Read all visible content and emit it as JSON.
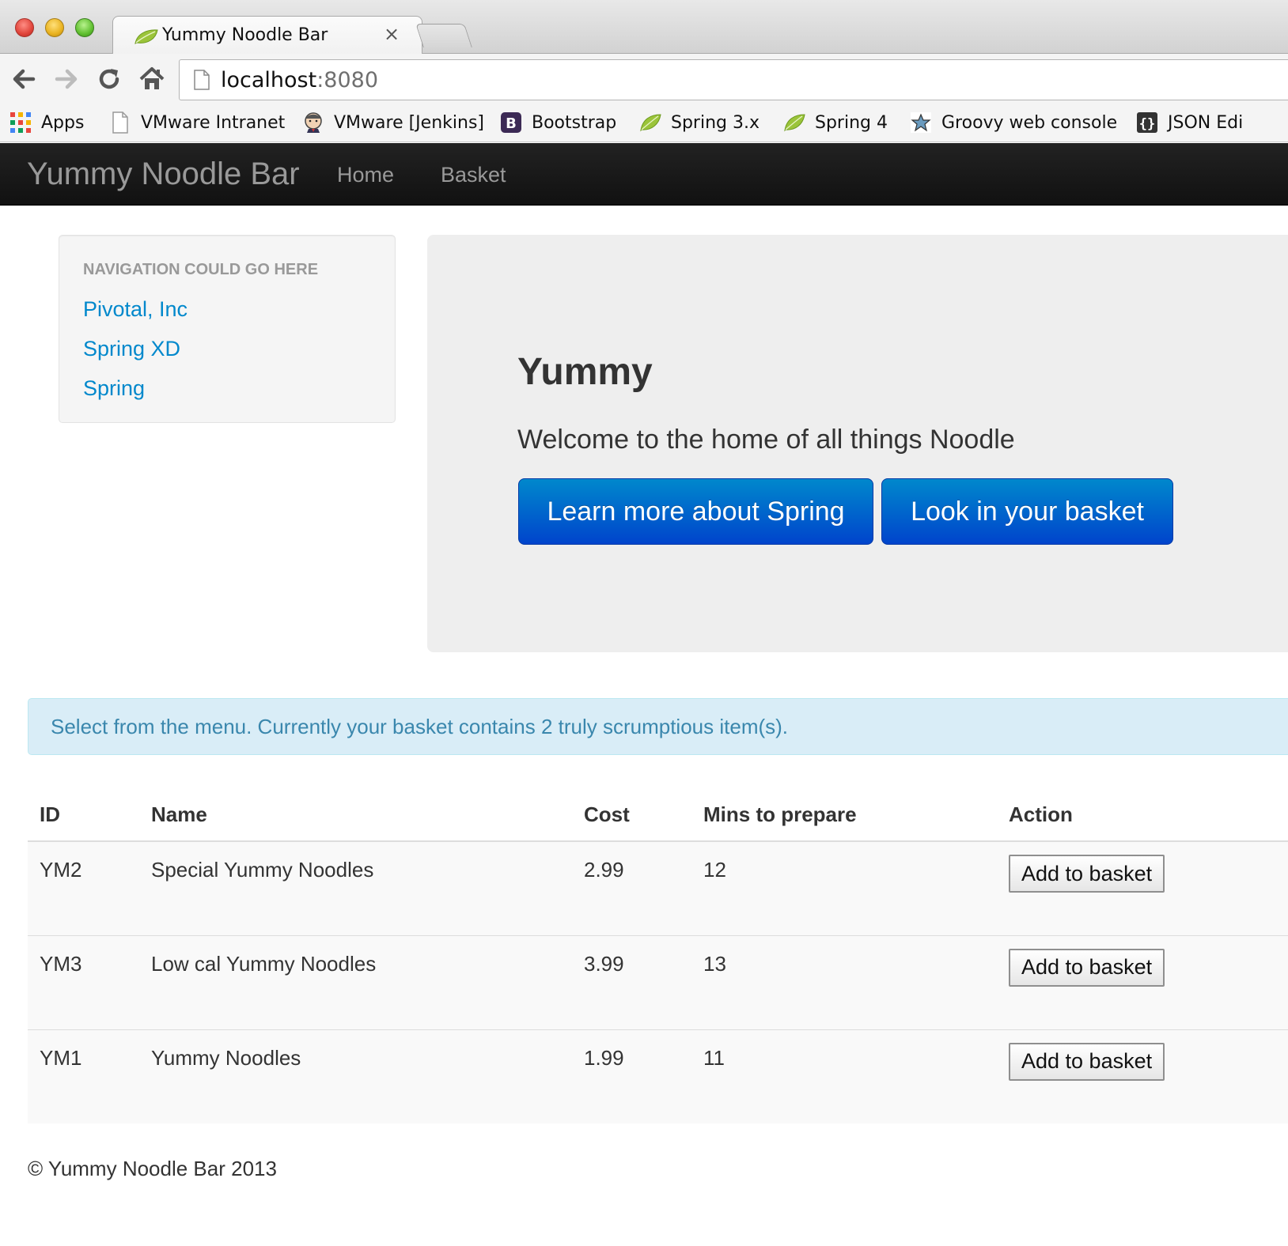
{
  "browser": {
    "tab_title": "Yummy Noodle Bar",
    "tab_close": "×",
    "url_host": "localhost",
    "url_port": ":8080",
    "bookmarks": [
      {
        "label": "Apps",
        "icon": "apps-grid-icon"
      },
      {
        "label": "VMware Intranet",
        "icon": "blank-page-icon"
      },
      {
        "label": "VMware [Jenkins]",
        "icon": "jenkins-icon"
      },
      {
        "label": "Bootstrap",
        "icon": "bootstrap-icon"
      },
      {
        "label": "Spring 3.x",
        "icon": "spring-leaf-icon"
      },
      {
        "label": "Spring 4",
        "icon": "spring-leaf-icon"
      },
      {
        "label": "Groovy web console",
        "icon": "groovy-star-icon"
      },
      {
        "label": "JSON Edi",
        "icon": "json-braces-icon"
      }
    ]
  },
  "navbar": {
    "brand": "Yummy Noodle Bar",
    "links": [
      "Home",
      "Basket"
    ]
  },
  "sidebar": {
    "header": "Navigation could go here",
    "links": [
      "Pivotal, Inc",
      "Spring XD",
      "Spring"
    ]
  },
  "hero": {
    "title": "Yummy",
    "text": "Welcome to the home of all things Noodle",
    "buttons": [
      "Learn more about Spring",
      "Look in your basket"
    ]
  },
  "alert": {
    "text": "Select from the menu. Currently your basket contains 2 truly scrumptious item(s)."
  },
  "menu_table": {
    "headers": [
      "ID",
      "Name",
      "Cost",
      "Mins to prepare",
      "Action"
    ],
    "rows": [
      {
        "id": "YM2",
        "name": "Special Yummy Noodles",
        "cost": "2.99",
        "mins": "12",
        "action": "Add to basket"
      },
      {
        "id": "YM3",
        "name": "Low cal Yummy Noodles",
        "cost": "3.99",
        "mins": "13",
        "action": "Add to basket"
      },
      {
        "id": "YM1",
        "name": "Yummy Noodles",
        "cost": "1.99",
        "mins": "11",
        "action": "Add to basket"
      }
    ]
  },
  "footer": "© Yummy Noodle Bar 2013",
  "colors": {
    "navbar_bg": "#1b1b1b",
    "link": "#0088cc",
    "primary_button": "#0055cc",
    "alert_bg": "#d9edf7",
    "alert_text": "#3a87ad"
  }
}
